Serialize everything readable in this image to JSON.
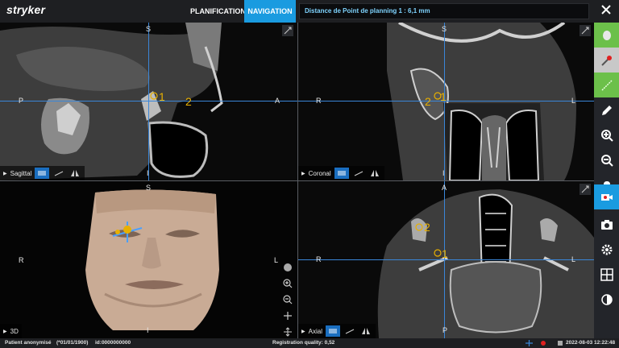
{
  "app": {
    "logo": "stryker"
  },
  "tabs": [
    {
      "label": "PLANIFICATION"
    },
    {
      "label": "NAVIGATION"
    }
  ],
  "message": "Distance de Point de planning 1 : 6,1 mm",
  "close_icon": "close-icon",
  "viewports": {
    "sagittal": {
      "label": "Sagittal",
      "top": "S",
      "bottom": "I",
      "left": "P",
      "right": "A",
      "points": [
        "1",
        "2"
      ]
    },
    "coronal": {
      "label": "Coronal",
      "top": "S",
      "bottom": "I",
      "left": "R",
      "right": "L",
      "points": [
        "2",
        "1"
      ]
    },
    "three_d": {
      "label": "3D",
      "top": "S",
      "bottom": "I",
      "left": "R",
      "right": "L"
    },
    "axial": {
      "label": "Axial",
      "top": "A",
      "bottom": "P",
      "left": "R",
      "right": "L",
      "points": [
        "2",
        "1"
      ]
    }
  },
  "toolbar": [
    {
      "icon": "instrument-head-icon",
      "color": "#6cc04a"
    },
    {
      "icon": "pointer-red-icon",
      "color": "#e02020"
    },
    {
      "icon": "trajectory-line-icon",
      "color": "#6cc04a"
    },
    {
      "icon": "pencil-icon"
    },
    {
      "icon": "zoom-in-icon"
    },
    {
      "icon": "zoom-out-icon"
    },
    {
      "icon": "bell-icon"
    },
    {
      "icon": "record-video-icon",
      "active": true
    },
    {
      "icon": "camera-icon"
    },
    {
      "icon": "settings-gear-icon"
    },
    {
      "icon": "layout-grid-icon"
    },
    {
      "icon": "contrast-icon"
    }
  ],
  "status": {
    "patient": "Patient anonymisé",
    "dob": "(*01/01/1900)",
    "id": "id:0000000000",
    "registration": "Registration quality: 0,52",
    "datetime": "2022-08-03 12:22:48"
  },
  "colors": {
    "accent": "#1a9be0",
    "crosshair": "#3a86d8",
    "point": "#e8b000"
  }
}
